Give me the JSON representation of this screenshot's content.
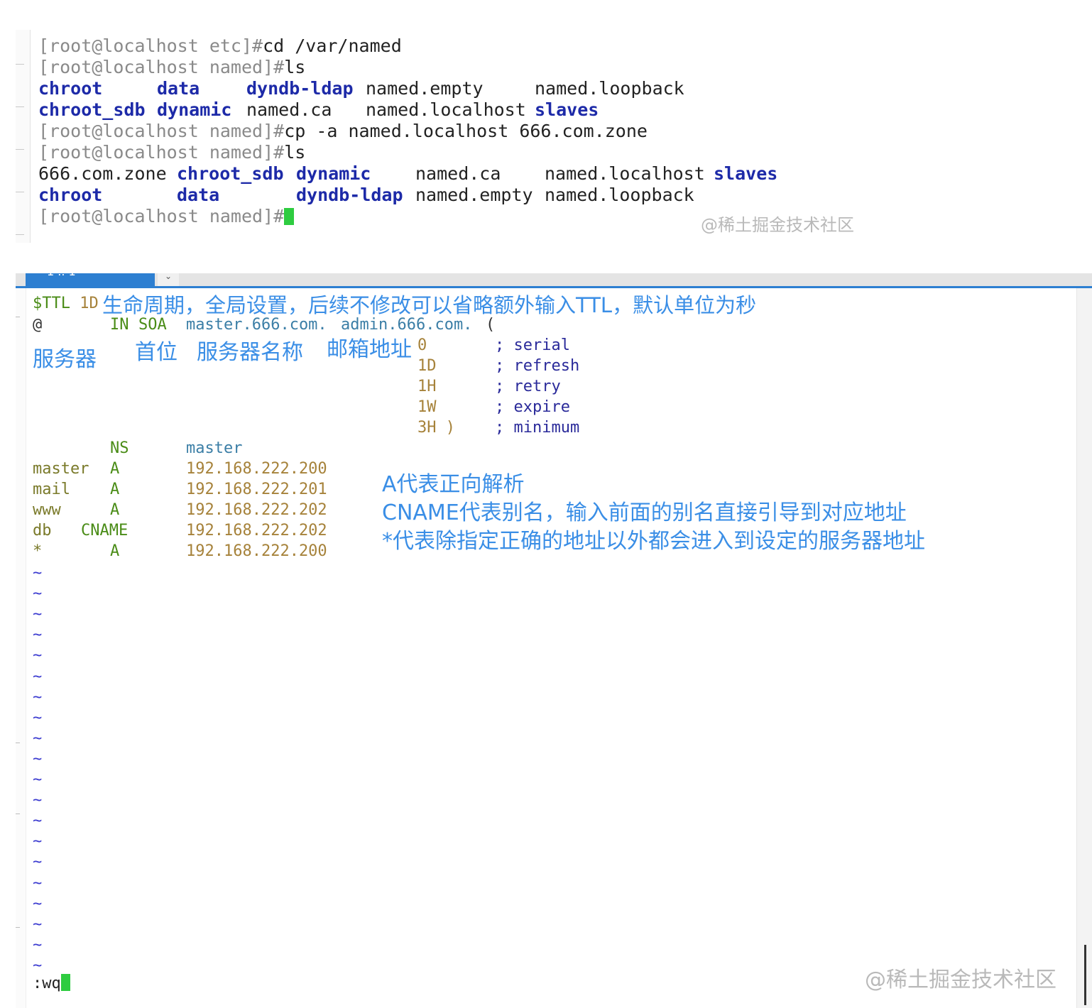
{
  "terminal": {
    "lines": [
      {
        "prompt": "[root@localhost etc]#",
        "cmd": "cd /var/named"
      },
      {
        "prompt": "[root@localhost named]#",
        "cmd": "ls"
      },
      {
        "prompt": "[root@localhost named]#",
        "cmd": "cp -a named.localhost 666.com.zone"
      },
      {
        "prompt": "[root@localhost named]#",
        "cmd": "ls"
      },
      {
        "prompt": "[root@localhost named]#",
        "cmd": ""
      }
    ],
    "ls1": {
      "row1": [
        "chroot",
        "data",
        "dyndb-ldap",
        "named.empty",
        "named.loopback"
      ],
      "row2": [
        "chroot_sdb",
        "dynamic",
        "named.ca",
        "named.localhost",
        "slaves"
      ]
    },
    "ls2": {
      "row1": [
        "666.com.zone",
        "chroot_sdb",
        "dynamic",
        "named.ca",
        "named.localhost",
        "slaves"
      ],
      "row2": [
        "chroot",
        "data",
        "dyndb-ldap",
        "named.empty",
        "named.loopback"
      ]
    },
    "watermark": "@稀土掘金技术社区"
  },
  "vim": {
    "ttl_line": {
      "ttl": "$TTL",
      "value": "1D"
    },
    "ttl_note": "生命周期，全局设置，后续不修改可以省略额外输入TTL，默认单位为秒",
    "soa_line": {
      "at": "@",
      "in": "IN",
      "soa": "SOA",
      "primary": "master.666.com.",
      "email": "admin.666.com.",
      "paren": "("
    },
    "labels": {
      "server": "服务器",
      "first": "首位",
      "server_name": "服务器名称",
      "email": "邮箱地址"
    },
    "soa_params": [
      {
        "value": "0",
        "comment": "; serial"
      },
      {
        "value": "1D",
        "comment": "; refresh"
      },
      {
        "value": "1H",
        "comment": "; retry"
      },
      {
        "value": "1W",
        "comment": "; expire"
      },
      {
        "value": "3H )",
        "comment": "; minimum"
      }
    ],
    "records": [
      {
        "name": "",
        "type": "NS",
        "value": "master"
      },
      {
        "name": "master",
        "type": "A",
        "value": "192.168.222.200"
      },
      {
        "name": "mail",
        "type": "A",
        "value": "192.168.222.201"
      },
      {
        "name": "www",
        "type": "A",
        "value": "192.168.222.202"
      },
      {
        "name": "db",
        "type": "CNAME",
        "value": "192.168.222.202"
      },
      {
        "name": "*",
        "type": "A",
        "value": "192.168.222.200"
      }
    ],
    "notes": [
      "A代表正向解析",
      "CNAME代表别名，输入前面的别名直接引导到对应地址",
      "*代表除指定正确的地址以外都会进入到设定的服务器地址"
    ],
    "tilde": "~",
    "command_line": ":wq",
    "watermark": "@稀土掘金技术社区"
  }
}
